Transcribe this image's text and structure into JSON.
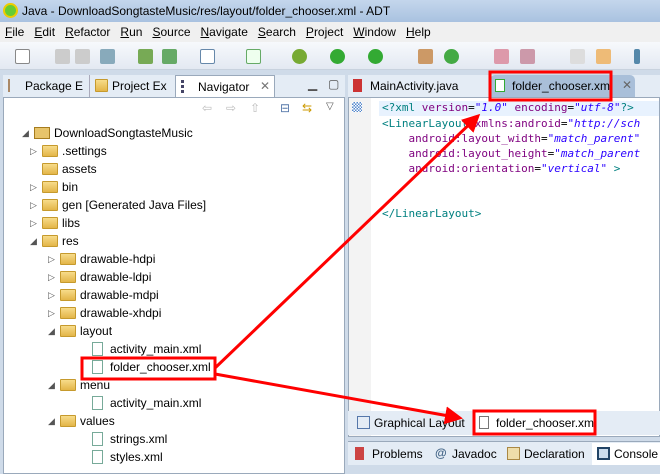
{
  "window": {
    "title": "Java - DownloadSongtasteMusic/res/layout/folder_chooser.xml - ADT"
  },
  "menu": [
    "File",
    "Edit",
    "Refactor",
    "Run",
    "Source",
    "Navigate",
    "Search",
    "Project",
    "Window",
    "Help"
  ],
  "left_tabs": [
    {
      "label": "Package E",
      "icon": "package-explorer-icon"
    },
    {
      "label": "Project Ex",
      "icon": "project-explorer-icon"
    },
    {
      "label": "Navigator",
      "icon": "navigator-icon"
    }
  ],
  "tree": [
    {
      "label": "DownloadSongtasteMusic",
      "level": 0,
      "type": "project",
      "expanded": true
    },
    {
      "label": ".settings",
      "level": 1,
      "type": "folder",
      "expanded": false
    },
    {
      "label": "assets",
      "level": 1,
      "type": "folder"
    },
    {
      "label": "bin",
      "level": 1,
      "type": "folder",
      "expanded": false
    },
    {
      "label": "gen [Generated Java Files]",
      "level": 1,
      "type": "folder",
      "expanded": false
    },
    {
      "label": "libs",
      "level": 1,
      "type": "folder",
      "expanded": false
    },
    {
      "label": "res",
      "level": 1,
      "type": "folder",
      "expanded": true
    },
    {
      "label": "drawable-hdpi",
      "level": 2,
      "type": "folder",
      "expanded": false
    },
    {
      "label": "drawable-ldpi",
      "level": 2,
      "type": "folder",
      "expanded": false
    },
    {
      "label": "drawable-mdpi",
      "level": 2,
      "type": "folder",
      "expanded": false
    },
    {
      "label": "drawable-xhdpi",
      "level": 2,
      "type": "folder",
      "expanded": false
    },
    {
      "label": "layout",
      "level": 2,
      "type": "folder",
      "expanded": true
    },
    {
      "label": "activity_main.xml",
      "level": 3,
      "type": "file"
    },
    {
      "label": "folder_chooser.xml",
      "level": 3,
      "type": "file"
    },
    {
      "label": "menu",
      "level": 2,
      "type": "folder",
      "expanded": true
    },
    {
      "label": "activity_main.xml",
      "level": 3,
      "type": "file"
    },
    {
      "label": "values",
      "level": 2,
      "type": "folder",
      "expanded": true
    },
    {
      "label": "strings.xml",
      "level": 3,
      "type": "file"
    },
    {
      "label": "styles.xml",
      "level": 3,
      "type": "file"
    }
  ],
  "editor_tabs": [
    {
      "label": "MainActivity.java",
      "active": false
    },
    {
      "label": "folder_chooser.xm",
      "active": true
    }
  ],
  "code": {
    "l1a": "<?xml ",
    "l1b": "version",
    "l1c": "=",
    "l1d": "\"1.0\"",
    "l1e": " encoding",
    "l1f": "=",
    "l1g": "\"utf-8\"",
    "l1h": "?>",
    "l2a": "<LinearLayout ",
    "l2b": "xmlns:android",
    "l2c": "=",
    "l2d": "\"http://sch",
    "l3a": "    android:layout_width",
    "l3b": "=",
    "l3c": "\"match_parent\"",
    "l4a": "    android:layout_height",
    "l4b": "=",
    "l4c": "\"match_parent",
    "l5a": "    android:orientation",
    "l5b": "=",
    "l5c": "\"vertical\"",
    "l5d": " >",
    "l6": "</LinearLayout>"
  },
  "editor_bottom_tabs": [
    {
      "label": "Graphical Layout",
      "active": false
    },
    {
      "label": "folder_chooser.xml",
      "active": true
    }
  ],
  "bottom_tabs": [
    "Problems",
    "Javadoc",
    "Declaration",
    "Console"
  ],
  "colors": {
    "annotation": "#ff0000",
    "selection": "#dbe6f4"
  }
}
